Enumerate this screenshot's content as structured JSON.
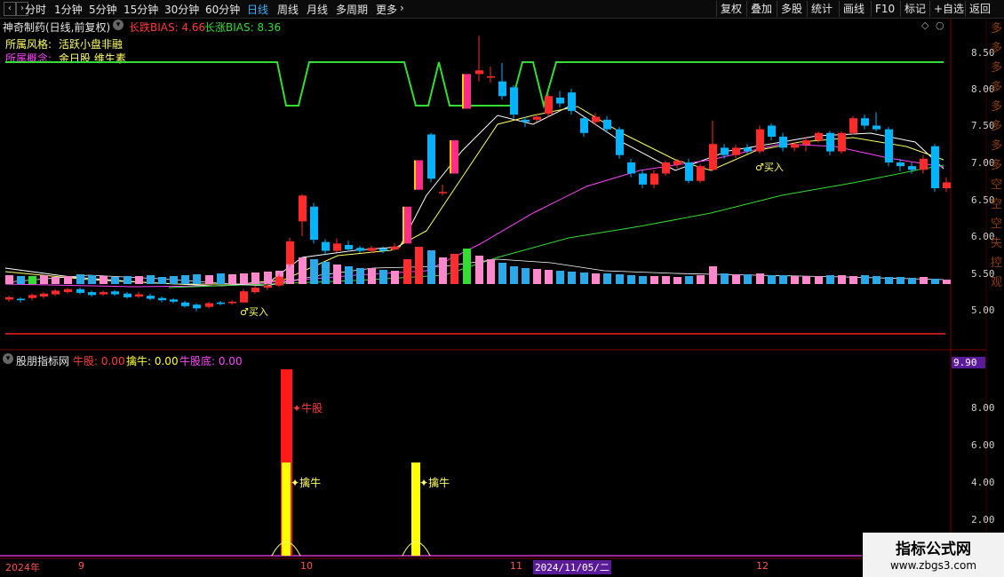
{
  "toolbar": {
    "periods": [
      "分时",
      "1分钟",
      "5分钟",
      "15分钟",
      "30分钟",
      "60分钟",
      "日线",
      "周线",
      "月线",
      "多周期",
      "更多"
    ],
    "active_period": "日线",
    "more_arrow": "›",
    "right_buttons": [
      "复权",
      "叠加",
      "多股",
      "统计",
      "画线",
      "F10",
      "标记",
      "+自选",
      "返回"
    ]
  },
  "header": {
    "stock_title": "神奇制药(日线,前复权)",
    "bias_down_label": "长跌BIAS: 4.66",
    "bias_up_label": "长涨BIAS: 8.36",
    "style_label": "所属风格:",
    "style_value": "活跃小盘非融",
    "command_label": "所属概念:",
    "command_value": "金日股 维生素"
  },
  "main_chart": {
    "y_ticks": [
      "8.50",
      "8.00",
      "7.50",
      "7.00",
      "6.50",
      "6.00",
      "5.50",
      "5.00"
    ],
    "buy_signal_label": "买入",
    "colors": {
      "up": "#ff2a2a",
      "down": "#00b4ff",
      "ma_white": "#ffffff",
      "ma_yellow": "#ffff66",
      "ma_purple": "#ff44ff",
      "ma_green": "#33dd33",
      "bias_line": "#33dd33",
      "limit_up": "#ff2d8a"
    }
  },
  "indicator": {
    "title": "股朋指标网",
    "niu_label": "牛股: 0.00",
    "qin_label": "擒牛: 0.00",
    "di_label": "牛股底: 0.00",
    "y_ticks": [
      "8.00",
      "6.00",
      "4.00",
      "2.00"
    ],
    "cursor_value": "9.90",
    "niu_tag": "牛股",
    "qin_tag": "擒牛",
    "colors": {
      "niu": "#ff1a1a",
      "qin": "#ffff00",
      "di": "#ff44ff"
    }
  },
  "date_axis": {
    "labels": [
      "2024年",
      "9",
      "10",
      "11",
      "12"
    ],
    "cursor_date": "2024/11/05/二"
  },
  "right_strip_chars": [
    "多",
    "多",
    "多",
    "多",
    "多",
    "多",
    "多",
    "多",
    "空",
    "空",
    "空",
    "失",
    "控",
    "观"
  ],
  "watermark": {
    "line1": "指标公式网",
    "line2": "www.zbgs3.com"
  }
}
